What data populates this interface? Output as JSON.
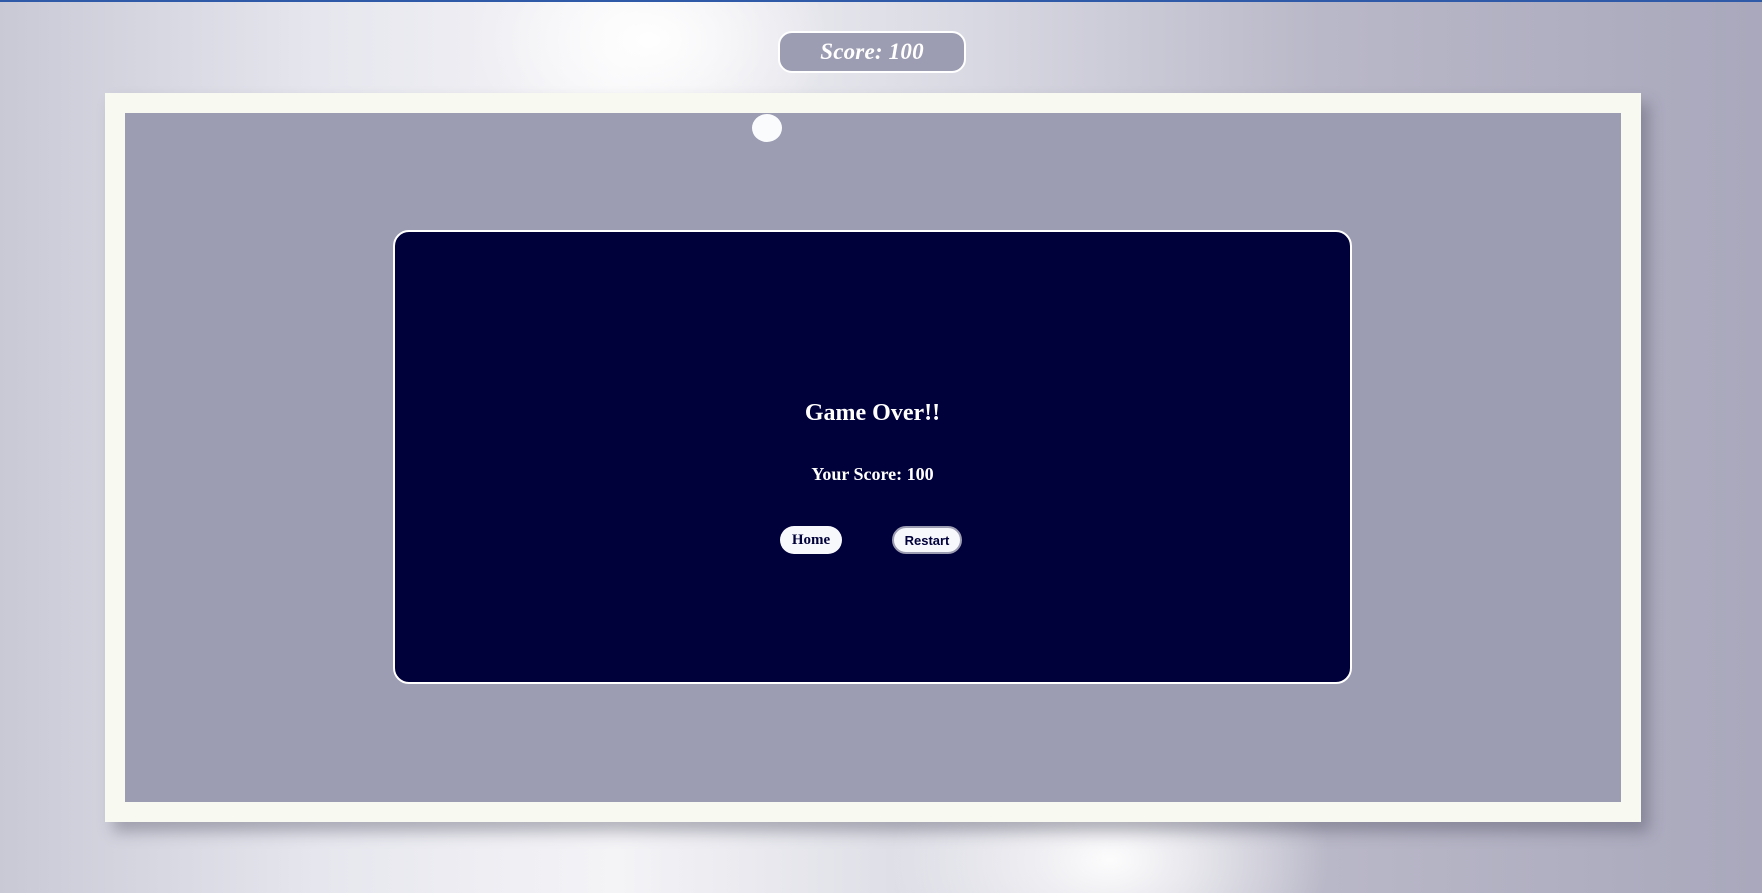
{
  "hud": {
    "score_label": "Score: 100"
  },
  "game_over": {
    "title": "Game Over!!",
    "score_text": "Your Score: 100",
    "home_label": "Home",
    "restart_label": "Restart"
  },
  "colors": {
    "board": "#9c9cb2",
    "frame": "#f8f9f1",
    "modal": "#00003a",
    "ball": "#fafbfd"
  }
}
